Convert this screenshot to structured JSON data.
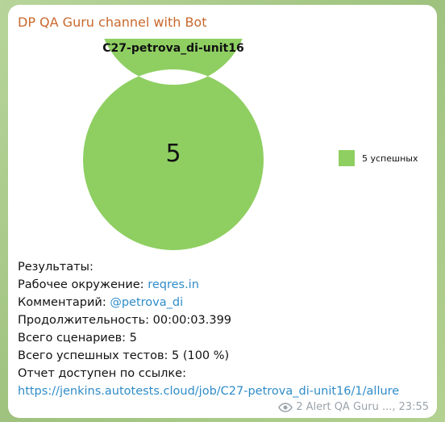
{
  "message": {
    "sender": "DP QA Guru channel with Bot",
    "lines": {
      "results": "Результаты:",
      "env_label": "Рабочее окружение:",
      "env_value": "reqres.in",
      "comment_label": "Комментарий:",
      "comment_value": "@petrova_di",
      "duration_label": "Продолжительность:",
      "duration_value": "00:00:03.399",
      "scenarios_label": "Всего сценариев:",
      "scenarios_value": "5",
      "passed_label": "Всего успешных тестов:",
      "passed_value": "5 (100 %)",
      "report_label": "Отчет доступен по ссылке:",
      "report_link": "https://jenkins.autotests.cloud/job/C27-petrova_di-unit16/1/allure"
    },
    "footer": {
      "views": "2",
      "author": "Alert QA Guru ...,",
      "time": "23:55"
    }
  },
  "chart_data": {
    "type": "pie",
    "title": "C27-petrova_di-unit16",
    "center_label": "5",
    "slices": [
      {
        "label": "5 успешных",
        "value": 5,
        "color": "#8fcf62"
      }
    ],
    "legend_position": "right"
  },
  "colors": {
    "sender": "#c8682d",
    "link": "#2f8cc8",
    "passed": "#8fcf62",
    "meta": "#9aa3ab"
  }
}
